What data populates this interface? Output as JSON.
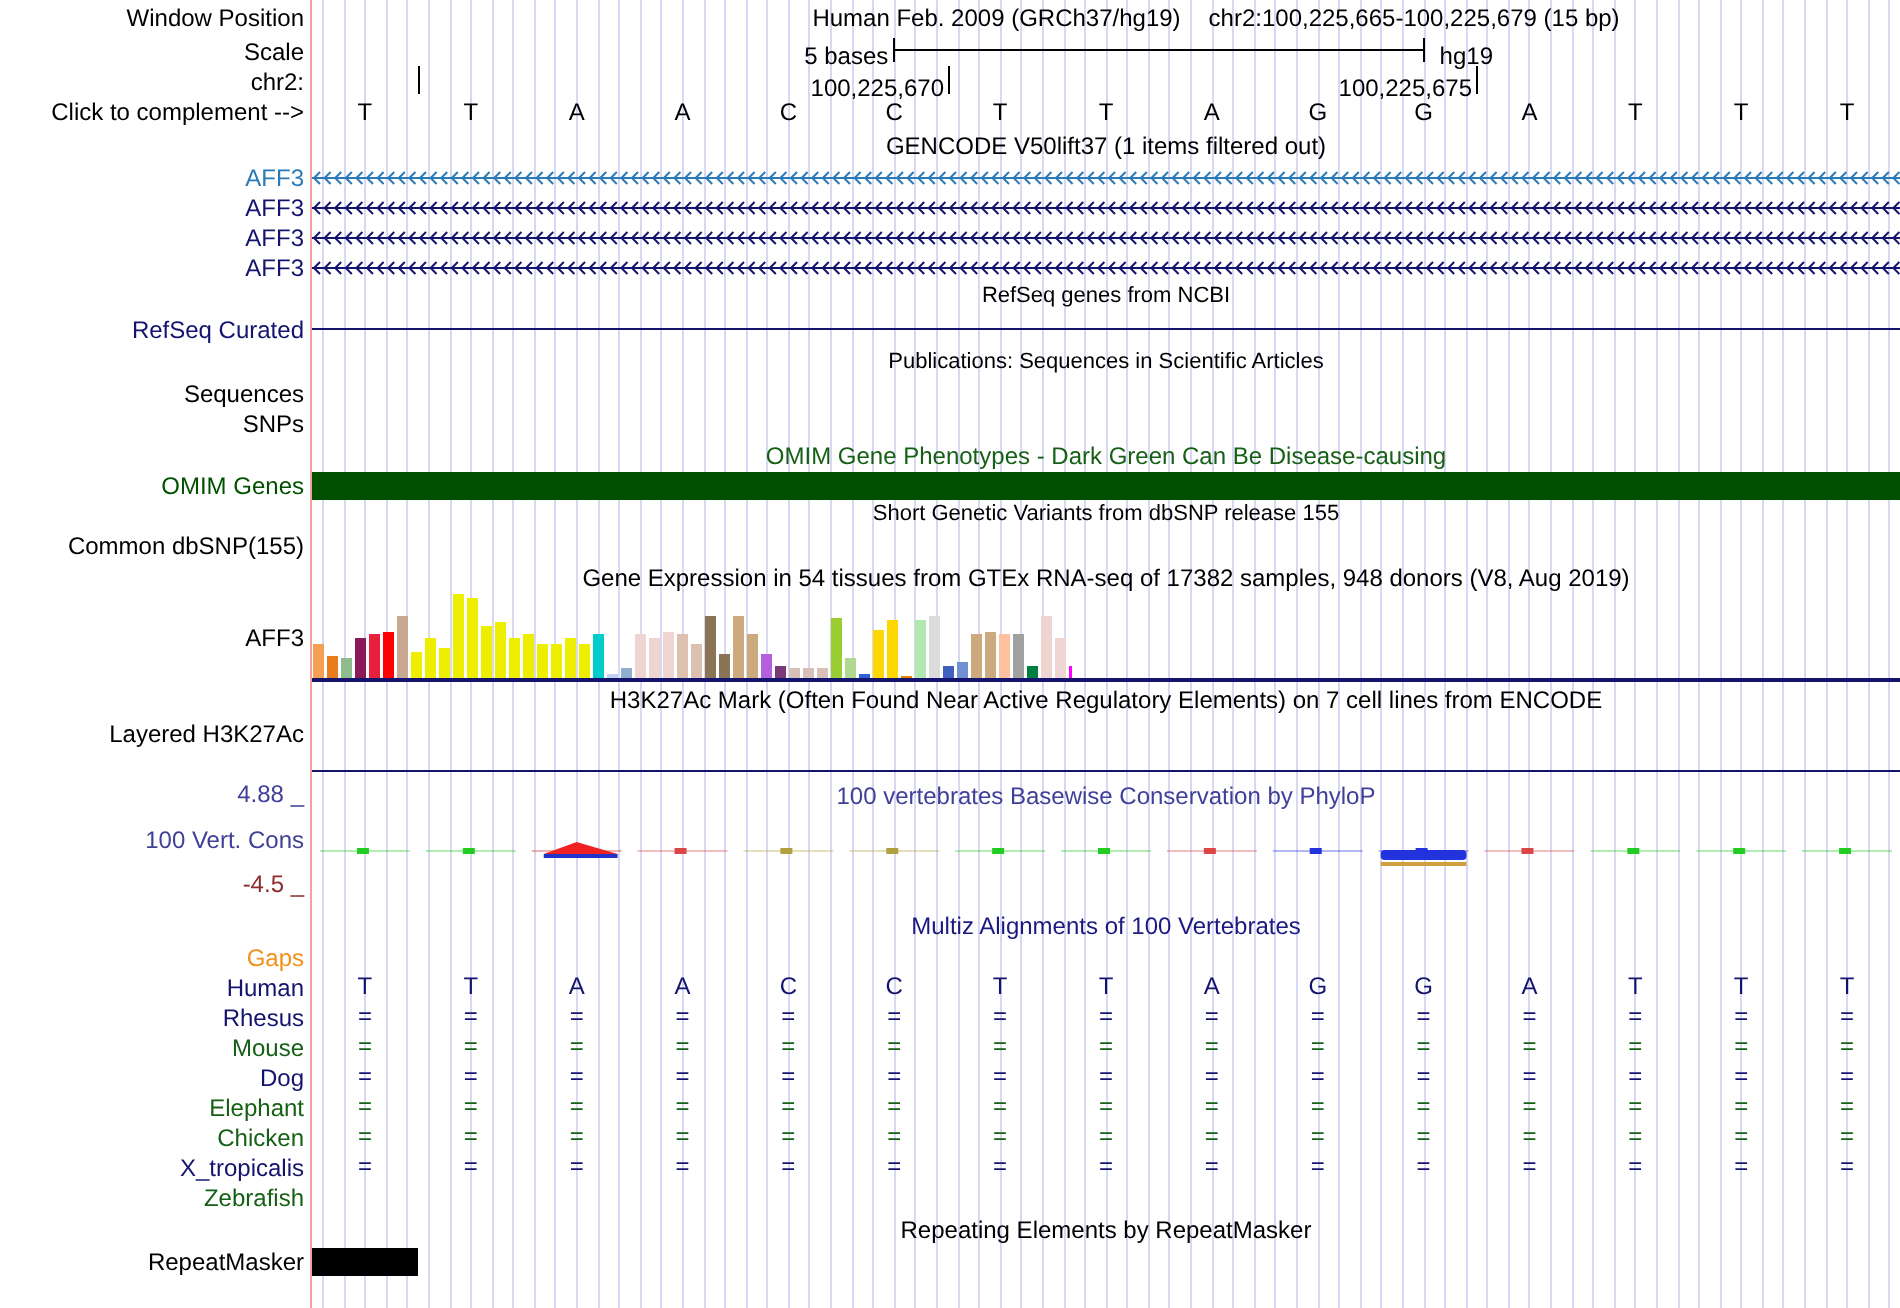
{
  "header": {
    "label": "Window Position",
    "assembly": "Human Feb. 2009 (GRCh37/hg19)",
    "range": "chr2:100,225,665-100,225,679 (15 bp)"
  },
  "scale": {
    "label": "Scale",
    "length": "5 bases",
    "assembly": "hg19"
  },
  "ruler": {
    "label": "chr2:",
    "ticks": [
      "100,225,670",
      "100,225,675"
    ]
  },
  "complement": {
    "label": "Click to complement -->",
    "bases": [
      "T",
      "T",
      "A",
      "A",
      "C",
      "C",
      "T",
      "T",
      "A",
      "G",
      "G",
      "A",
      "T",
      "T",
      "T"
    ]
  },
  "tracks": [
    {
      "kind": "title",
      "text": "GENCODE V50lift37 (1 items filtered out)"
    },
    {
      "kind": "gene",
      "label": "AFF3",
      "color": "#2a7ab8"
    },
    {
      "kind": "gene",
      "label": "AFF3",
      "color": "#14146e"
    },
    {
      "kind": "gene",
      "label": "AFF3",
      "color": "#14146e"
    },
    {
      "kind": "gene",
      "label": "AFF3",
      "color": "#14146e"
    },
    {
      "kind": "small_title",
      "text": "RefSeq genes from NCBI"
    },
    {
      "kind": "line",
      "label": "RefSeq Curated",
      "color": "#14146e"
    },
    {
      "kind": "small_title",
      "text": "Publications: Sequences in Scientific Articles"
    },
    {
      "kind": "label",
      "label": "Sequences"
    },
    {
      "kind": "label",
      "label": "SNPs"
    },
    {
      "kind": "title",
      "text": "OMIM Gene Phenotypes - Dark Green Can Be Disease-causing",
      "color": "#166016"
    },
    {
      "kind": "bar",
      "label": "OMIM Genes",
      "color": "#005000"
    },
    {
      "kind": "small_title",
      "text": "Short Genetic Variants from dbSNP release 155"
    },
    {
      "kind": "label",
      "label": "Common dbSNP(155)"
    },
    {
      "kind": "title",
      "text": "Gene Expression in 54 tissues from GTEx RNA-seq of 17382 samples, 948 donors (V8, Aug 2019)"
    },
    {
      "kind": "expression",
      "label": "AFF3"
    },
    {
      "kind": "title",
      "text": "H3K27Ac Mark (Often Found Near Active Regulatory Elements) on 7 cell lines from ENCODE"
    },
    {
      "kind": "signal",
      "label": "Layered H3K27Ac"
    },
    {
      "kind": "conservation",
      "title": "100 vertebrates Basewise Conservation by PhyloP",
      "label": "100 Vert. Cons",
      "max": "4.88 _",
      "min": "-4.5 _"
    },
    {
      "kind": "title",
      "text": "Multiz Alignments of 100 Vertebrates",
      "color": "#1a1a80"
    },
    {
      "kind": "species",
      "label": "Gaps",
      "color": "#f0901a"
    },
    {
      "kind": "species",
      "label": "Human",
      "color": "#14146e",
      "bases": [
        "T",
        "T",
        "A",
        "A",
        "C",
        "C",
        "T",
        "T",
        "A",
        "G",
        "G",
        "A",
        "T",
        "T",
        "T"
      ]
    },
    {
      "kind": "species",
      "label": "Rhesus",
      "color": "#14146e",
      "bases": [
        "=",
        "=",
        "=",
        "=",
        "=",
        "=",
        "=",
        "=",
        "=",
        "=",
        "=",
        "=",
        "=",
        "=",
        "="
      ]
    },
    {
      "kind": "species",
      "label": "Mouse",
      "color": "#166016",
      "bases": [
        "=",
        "=",
        "=",
        "=",
        "=",
        "=",
        "=",
        "=",
        "=",
        "=",
        "=",
        "=",
        "=",
        "=",
        "="
      ]
    },
    {
      "kind": "species",
      "label": "Dog",
      "color": "#14146e",
      "bases": [
        "=",
        "=",
        "=",
        "=",
        "=",
        "=",
        "=",
        "=",
        "=",
        "=",
        "=",
        "=",
        "=",
        "=",
        "="
      ]
    },
    {
      "kind": "species",
      "label": "Elephant",
      "color": "#166016",
      "bases": [
        "=",
        "=",
        "=",
        "=",
        "=",
        "=",
        "=",
        "=",
        "=",
        "=",
        "=",
        "=",
        "=",
        "=",
        "="
      ]
    },
    {
      "kind": "species",
      "label": "Chicken",
      "color": "#166016",
      "bases": [
        "=",
        "=",
        "=",
        "=",
        "=",
        "=",
        "=",
        "=",
        "=",
        "=",
        "=",
        "=",
        "=",
        "=",
        "="
      ]
    },
    {
      "kind": "species",
      "label": "X_tropicalis",
      "color": "#14146e",
      "bases": [
        "=",
        "=",
        "=",
        "=",
        "=",
        "=",
        "=",
        "=",
        "=",
        "=",
        "=",
        "=",
        "=",
        "=",
        "="
      ]
    },
    {
      "kind": "species",
      "label": "Zebrafish",
      "color": "#166016"
    },
    {
      "kind": "title",
      "text": "Repeating Elements by RepeatMasker"
    },
    {
      "kind": "repeat",
      "label": "RepeatMasker"
    }
  ]
}
